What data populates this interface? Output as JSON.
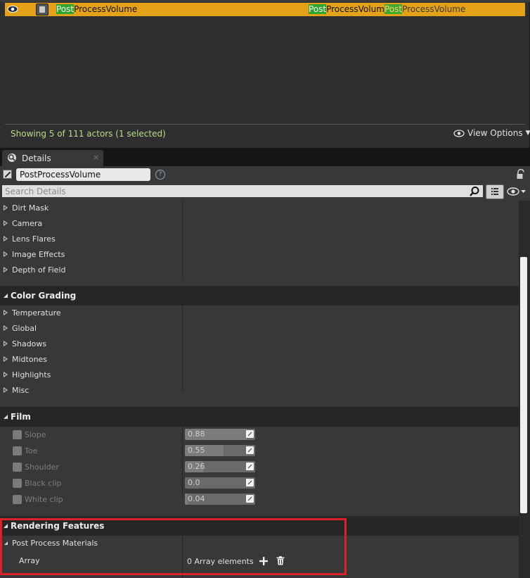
{
  "outliner": {
    "selected_actor": {
      "name_highlight": "Post",
      "name_rest": "ProcessVolume",
      "type_highlight": "Post",
      "type_rest": "ProcessVolume",
      "type2_highlight": "Post",
      "type2_rest": "ProcessVolume"
    },
    "status_text": "Showing 5 of 111 actors (1 selected)",
    "view_options_label": "View Options"
  },
  "details": {
    "tab_label": "Details",
    "tab_close": "×",
    "object_name": "PostProcessVolume",
    "search_placeholder": "Search Details",
    "collapsed_rows_top": [
      "Dirt Mask",
      "Camera",
      "Lens Flares",
      "Image Effects",
      "Depth of Field"
    ],
    "color_grading": {
      "title": "Color Grading",
      "rows": [
        "Temperature",
        "Global",
        "Shadows",
        "Midtones",
        "Highlights",
        "Misc"
      ]
    },
    "film": {
      "title": "Film",
      "rows": [
        {
          "label": "Slope",
          "value": "0.88",
          "fill": 0.88
        },
        {
          "label": "Toe",
          "value": "0.55",
          "fill": 0.55
        },
        {
          "label": "Shoulder",
          "value": "0.26",
          "fill": 0.26
        },
        {
          "label": "Black clip",
          "value": "0.0",
          "fill": 0.0
        },
        {
          "label": "White clip",
          "value": "0.04",
          "fill": 0.04
        }
      ]
    },
    "rendering_features": {
      "title": "Rendering Features",
      "subgroup": "Post Process Materials",
      "array_label": "Array",
      "array_value": "0 Array elements"
    }
  },
  "colors": {
    "selection_row": "#e3a21a",
    "search_highlight": "#2fa52f",
    "status_text": "#b8dc8c",
    "annotation_box": "#d9222a"
  },
  "icons": [
    "eye-icon",
    "actor-icon",
    "view-eye-icon",
    "details-tab-icon",
    "help-icon",
    "lock-icon",
    "search-icon",
    "list-view-icon",
    "visibility-icon",
    "add-icon",
    "trash-icon"
  ]
}
